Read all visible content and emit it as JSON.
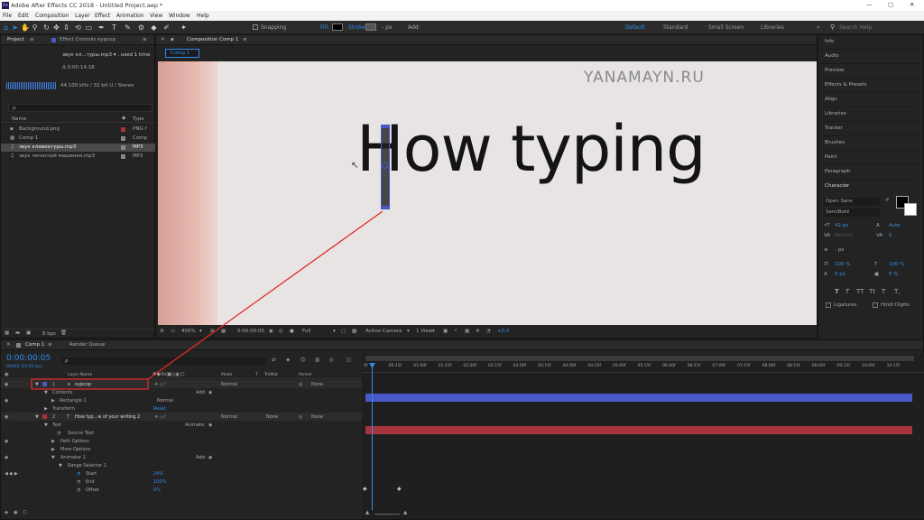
{
  "window": {
    "title": "Adobe After Effects CC 2018 - Untitled Project.aep *"
  },
  "menu": [
    "File",
    "Edit",
    "Composition",
    "Layer",
    "Effect",
    "Animation",
    "View",
    "Window",
    "Help"
  ],
  "toolbar": {
    "snapping": "Snapping",
    "fill": "Fill:",
    "stroke": "Stroke:",
    "stroke_unit": "- px",
    "add": "Add:",
    "workspaces": [
      "Default",
      "Standard",
      "Small Screen",
      "Libraries"
    ],
    "search_placeholder": "Search Help"
  },
  "project": {
    "tab": "Project",
    "effect_tab": "Effect Controls курсор",
    "item_name": "звук кл...туры.mp3 ▾ , used 1 time",
    "duration": "Δ 0:00:14:18",
    "audio_info": "44,100 kHz / 32 bit U / Stereo",
    "search_placeholder": "ρ",
    "col_name": "Name",
    "col_type": "Type",
    "items": [
      {
        "name": "Background.png",
        "type": "PNG f"
      },
      {
        "name": "Comp 1",
        "type": "Comp"
      },
      {
        "name": "звук клавиатуры.mp3",
        "type": "MP3"
      },
      {
        "name": "звук печатной машинки.mp3",
        "type": "MP3"
      }
    ],
    "bpc": "8 bpc"
  },
  "comp": {
    "tab": "Composition Comp 1",
    "subtab": "Comp 1",
    "watermark": "YANAMAYN.RU",
    "canvas_text": "How typing",
    "zoom": "400%",
    "timecode": "0:00:00:05",
    "resolution": "Full",
    "camera": "Active Camera",
    "view": "1 View",
    "exposure": "+0,0"
  },
  "timeline": {
    "tab": "Comp 1",
    "render_queue": "Render Queue",
    "current_time": "0:00:00:05",
    "fps": "00005 (25.00 fps)",
    "search_placeholder": "ρ",
    "headers": {
      "layer_name": "Layer Name",
      "mode": "Mode",
      "t": "T",
      "trkmat": "TrkMat",
      "parent": "Parent"
    },
    "ruler": [
      "0f",
      "00:15f",
      "01:00f",
      "01:15f",
      "02:00f",
      "02:15f",
      "03:00f",
      "03:15f",
      "04:00f",
      "04:15f",
      "05:00f",
      "05:15f",
      "06:00f",
      "06:15f",
      "07:00f",
      "07:15f",
      "08:00f",
      "08:15f",
      "09:00f",
      "09:15f",
      "10:00f",
      "10:15f"
    ],
    "rows": [
      {
        "num": "1",
        "name": "курсор",
        "mode": "Normal",
        "parent": "None"
      },
      {
        "label": "Contents",
        "extra": "Add:"
      },
      {
        "label": "Rectangle 1",
        "mode": "Normal"
      },
      {
        "label": "Transform",
        "value": "Reset"
      },
      {
        "num": "2",
        "name": "How typ...w of your writing 2",
        "mode": "Normal",
        "trkmat": "None",
        "parent": "None"
      },
      {
        "label": "Text",
        "extra": "Animate:"
      },
      {
        "label": "Source Text"
      },
      {
        "label": "Path Options"
      },
      {
        "label": "More Options"
      },
      {
        "label": "Animator 1",
        "extra": "Add:"
      },
      {
        "label": "Range Selector 1"
      },
      {
        "label": "Start",
        "value": "24%"
      },
      {
        "label": "End",
        "value": "100%"
      },
      {
        "label": "Offset",
        "value": "0%"
      }
    ]
  },
  "right_panels": [
    "Info",
    "Audio",
    "Preview",
    "Effects & Presets",
    "Align",
    "Libraries",
    "Tracker",
    "Brushes",
    "Paint",
    "Paragraph"
  ],
  "character": {
    "title": "Character",
    "font": "Open Sans",
    "style": "SemiBold",
    "size": "42 px",
    "leading": "Auto",
    "kerning": "Metrics",
    "tracking": "0",
    "stroke_width": "- px",
    "vscale": "100 %",
    "hscale": "100 %",
    "baseline": "0 px",
    "tsume": "0 %",
    "styles": [
      "T",
      "T",
      "TT",
      "Tt",
      "T",
      "T,"
    ],
    "ligatures": "Ligatures",
    "hindi": "Hindi Digits"
  },
  "colors": {
    "accent": "#2d8ceb",
    "layer1": "#4a58c8",
    "layer2": "#a7343a",
    "red_annot": "#e02a2a"
  }
}
